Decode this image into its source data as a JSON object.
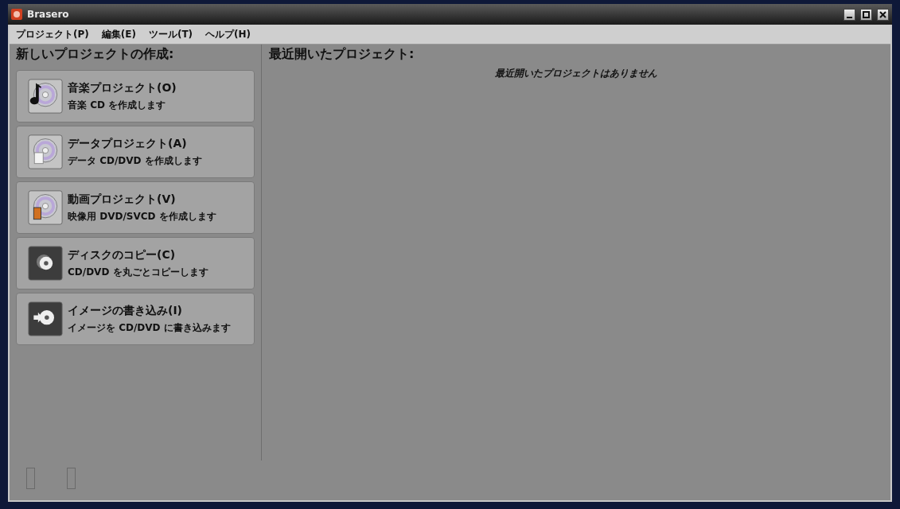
{
  "window": {
    "title": "Brasero"
  },
  "menu": [
    "プロジェクト(P)",
    "編集(E)",
    "ツール(T)",
    "ヘルプ(H)"
  ],
  "new_project": {
    "heading": "新しいプロジェクトの作成:",
    "items": [
      {
        "kind": "music",
        "title": "音楽プロジェクト(O)",
        "description": "音楽 CD を作成します"
      },
      {
        "kind": "data",
        "title": "データプロジェクト(A)",
        "description": "データ CD/DVD を作成します"
      },
      {
        "kind": "video",
        "title": "動画プロジェクト(V)",
        "description": "映像用 DVD/SVCD を作成します"
      },
      {
        "kind": "copy",
        "title": "ディスクのコピー(C)",
        "description": "CD/DVD を丸ごとコピーします"
      },
      {
        "kind": "burn",
        "title": "イメージの書き込み(I)",
        "description": "イメージを CD/DVD に書き込みます"
      }
    ]
  },
  "recent": {
    "heading": "最近開いたプロジェクト:",
    "empty_message": "最近開いたプロジェクトはありません"
  }
}
